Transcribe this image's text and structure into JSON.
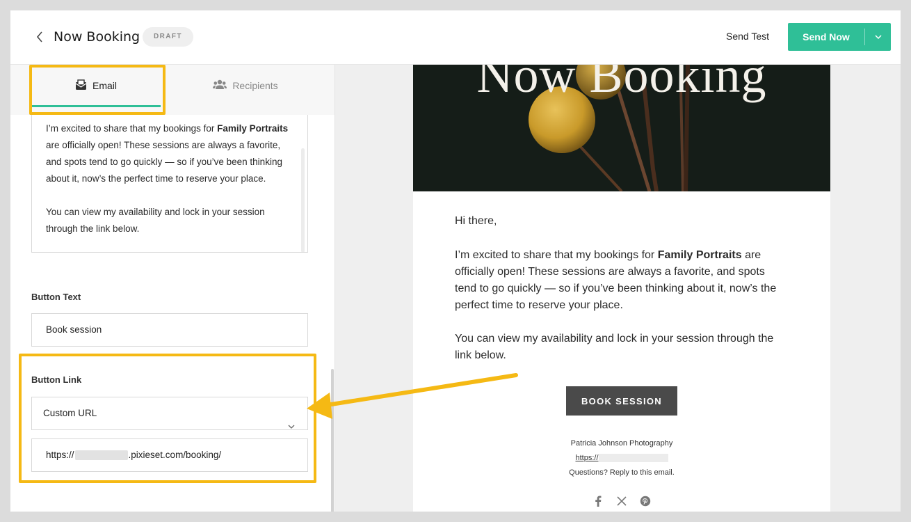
{
  "header": {
    "title": "Now Booking",
    "badge": "DRAFT",
    "send_test": "Send Test",
    "send_now": "Send Now"
  },
  "tabs": [
    {
      "label": "Email",
      "icon": "envelope-icon",
      "active": true
    },
    {
      "label": "Recipients",
      "icon": "people-icon",
      "active": false
    }
  ],
  "editor": {
    "body_p1_pre": "I’m excited to share that my bookings for ",
    "body_p1_bold": "Family Portraits",
    "body_p1_post": " are officially open! These sessions are always a favorite, and spots tend to go quickly — so if you’ve been thinking about it, now’s the perfect time to reserve your place.",
    "body_p2": "You can view my availability and lock in your session through the link below.",
    "button_text_label": "Button Text",
    "button_text_value": "Book session",
    "button_link_label": "Button Link",
    "button_link_type": "Custom URL",
    "button_link_prefix": "https://",
    "button_link_suffix": ".pixieset.com/booking/"
  },
  "preview": {
    "hero_title": "Now Booking",
    "greeting": "Hi there,",
    "p1_pre": "I’m excited to share that my bookings for ",
    "p1_bold": "Family Portraits",
    "p1_post": " are officially open! These sessions are always a favorite, and spots tend to go quickly — so if you’ve been thinking about it, now’s the perfect time to reserve your place.",
    "p2": "You can view my availability and lock in your session through the link below.",
    "button": "BOOK SESSION",
    "footer_name": "Patricia Johnson Photography",
    "footer_link_prefix": "https://",
    "footer_note": "Questions? Reply to this email."
  },
  "colors": {
    "accent": "#2fbf97",
    "highlight": "#f5b914",
    "button_dark": "#4a4a4a"
  }
}
